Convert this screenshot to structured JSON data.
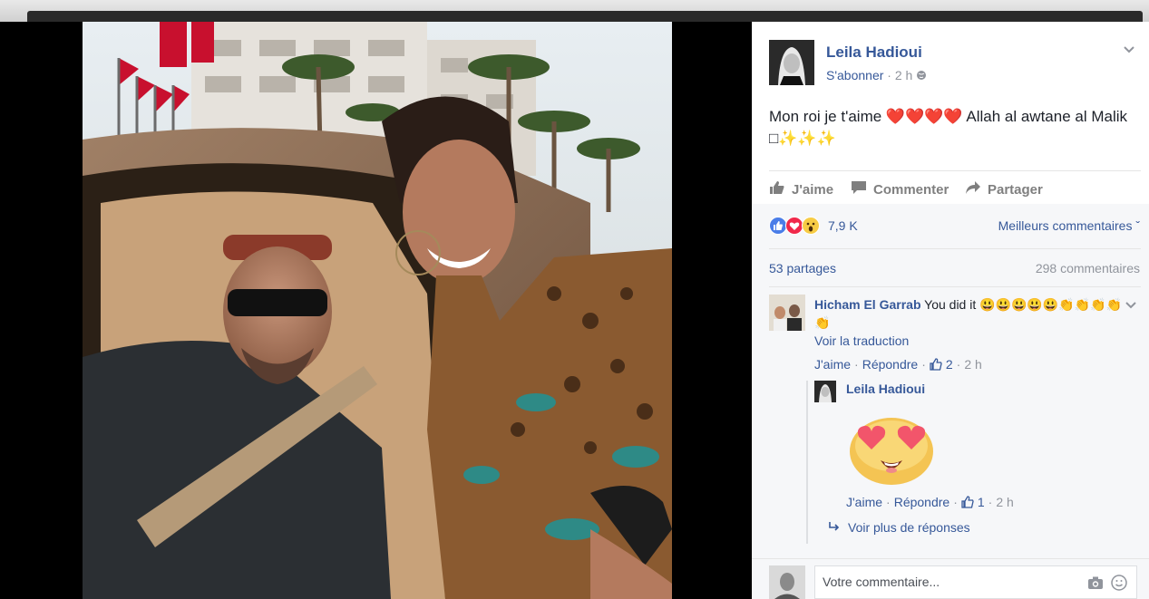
{
  "post": {
    "author": "Leila Hadioui",
    "subscribe": "S'abonner",
    "sep": "·",
    "time": "2 h",
    "text_line1": "Mon roi je t'aime ❤️❤️❤️❤️ Allah al awtane al Malik",
    "text_line2": "□✨✨✨"
  },
  "actions": {
    "like": "J'aime",
    "comment": "Commenter",
    "share": "Partager"
  },
  "reactions": {
    "count": "7,9 K",
    "sort_label": "Meilleurs commentaires ˇ",
    "shares": "53 partages",
    "comments": "298 commentaires"
  },
  "comment": {
    "author": "Hicham El Garrab",
    "text": "You did it 😃😃😃😃😃👏👏👏👏👏",
    "translate": "Voir la traduction",
    "like": "J'aime",
    "dot": "·",
    "reply": "Répondre",
    "likes": "2",
    "time": "2 h"
  },
  "reply": {
    "author": "Leila Hadioui",
    "like": "J'aime",
    "dot": "·",
    "reply": "Répondre",
    "likes": "1",
    "time": "2 h",
    "more": "Voir plus de réponses"
  },
  "composer": {
    "placeholder": "Votre commentaire..."
  },
  "colors": {
    "link": "#365899",
    "muted": "#90949c",
    "bg": "#f6f7f9"
  }
}
